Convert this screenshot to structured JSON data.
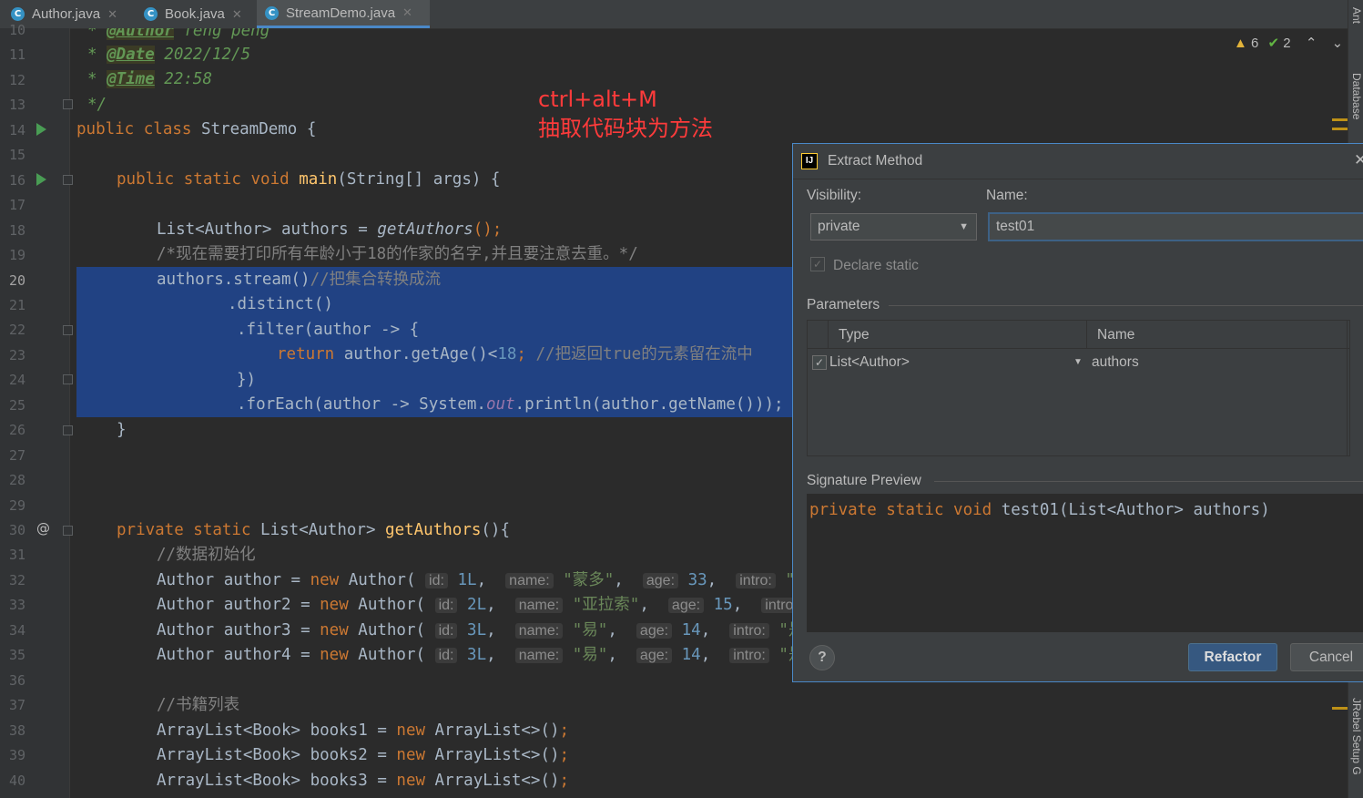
{
  "tabs": [
    {
      "label": "Author.java",
      "icon": "C"
    },
    {
      "label": "Book.java",
      "icon": "C"
    },
    {
      "label": "StreamDemo.java",
      "icon": "C"
    }
  ],
  "line_numbers": [
    "10",
    "11",
    "12",
    "13",
    "14",
    "15",
    "16",
    "17",
    "18",
    "19",
    "20",
    "21",
    "22",
    "23",
    "24",
    "25",
    "26",
    "27",
    "28",
    "29",
    "30",
    "31",
    "32",
    "33",
    "34",
    "35",
    "36",
    "37",
    "38",
    "39",
    "40"
  ],
  "code": {
    "l10_tag": "@Author",
    "l10_val": " feng peng",
    "l11_tag": "@Date",
    "l11_val": " 2022/12/5",
    "l12_tag": "@Time",
    "l12_val": " 22:58",
    "l13": "*/",
    "l14_kw": "public class",
    "l14_rest": " StreamDemo {",
    "l16_kw": "public static void",
    "l16_fn": "main",
    "l16_rest": "(String[] args) {",
    "l18_a": "List<Author> authors = ",
    "l18_fn": "getAuthors",
    "l18_b": "();",
    "l19": "/*现在需要打印所有年龄小于18的作家的名字,并且要注意去重。*/",
    "l20_a": "authors.stream()",
    "l20_c": "//把集合转换成流",
    "l21": ".distinct()",
    "l22": ".filter(author -> {",
    "l23_kw": "return",
    "l23_a": " author.getAge()<",
    "l23_num": "18",
    "l23_b": "; ",
    "l23_c": "//把返回true的元素留在流中",
    "l24": "})",
    "l25_a": ".forEach(author -> System.",
    "l25_out": "out",
    "l25_b": ".println(author.getName()));",
    "l26": "}",
    "l30_kw": "private static",
    "l30_a": " List<Author> ",
    "l30_fn": "getAuthors",
    "l30_b": "(){",
    "l31": "//数据初始化",
    "authors": [
      {
        "var": "author",
        "id": "1L",
        "name": "\"蒙多\"",
        "age": "33",
        "intro": "\"一"
      },
      {
        "var": "author2",
        "id": "2L",
        "name": "\"亚拉索\"",
        "age": "15",
        "intro": ""
      },
      {
        "var": "author3",
        "id": "3L",
        "name": "\"易\"",
        "age": "14",
        "intro": "\"是"
      },
      {
        "var": "author4",
        "id": "3L",
        "name": "\"易\"",
        "age": "14",
        "intro": "\"是"
      }
    ],
    "l37": "//书籍列表",
    "books": [
      "books1",
      "books2",
      "books3"
    ]
  },
  "annotation": {
    "line1": "ctrl+alt+M",
    "line2": "抽取代码块为方法"
  },
  "inspections": {
    "warnings": "6",
    "ok": "2"
  },
  "right_panels": [
    "Ant",
    "Database",
    "JRebel Setup G"
  ],
  "dialog": {
    "title": "Extract Method",
    "visibility_label": "Visibility:",
    "visibility_value": "private",
    "name_label": "Name:",
    "name_value": "test01",
    "declare_static": "Declare static",
    "parameters_label": "Parameters",
    "col_type": "Type",
    "col_name": "Name",
    "param_type": "List<Author>",
    "param_name": "authors",
    "signature_label": "Signature Preview",
    "signature_kw": "private static void",
    "signature_rest": " test01(List<Author> authors)",
    "refactor": "Refactor",
    "cancel": "Cancel",
    "help": "?"
  },
  "colors": {
    "selection": "#214283",
    "accent": "#4a88c7",
    "annotation": "#ff3b3b"
  }
}
